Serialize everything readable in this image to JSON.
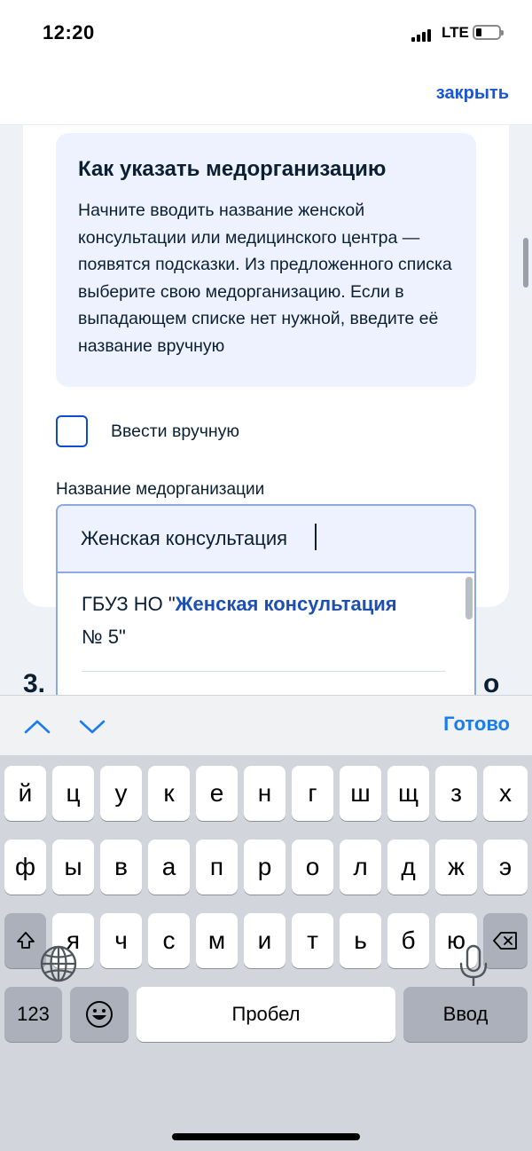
{
  "status_bar": {
    "time": "12:20",
    "network": "LTE"
  },
  "header": {
    "close_label": "закрыть"
  },
  "info_card": {
    "title": "Как указать медорганизацию",
    "text": "Начните вводить название женской консультации или медицинского центра — появятся подсказки. Из предложенного списка выберите свою медорганизацию. Если в выпадающем списке нет нужной, введите её название вручную"
  },
  "manual_checkbox": {
    "label": "Ввести вручную",
    "checked": false
  },
  "org_field": {
    "label": "Название медорганизации",
    "value": "Женская консультация"
  },
  "suggestions": [
    {
      "prefix": "ГБУЗ НО \"",
      "match": "Женская консультация",
      "suffix": "№ 5\""
    }
  ],
  "step": {
    "number": "3.",
    "tail": "о"
  },
  "accessory": {
    "done_label": "Готово"
  },
  "keyboard": {
    "row1": [
      "й",
      "ц",
      "у",
      "к",
      "е",
      "н",
      "г",
      "ш",
      "щ",
      "з",
      "х"
    ],
    "row2": [
      "ф",
      "ы",
      "в",
      "а",
      "п",
      "р",
      "о",
      "л",
      "д",
      "ж",
      "э"
    ],
    "row3": [
      "я",
      "ч",
      "с",
      "м",
      "и",
      "т",
      "ь",
      "б",
      "ю"
    ],
    "numbers_label": "123",
    "space_label": "Пробел",
    "return_label": "Ввод"
  },
  "colors": {
    "accent": "#0d4cd3",
    "info_bg": "#edf2fe",
    "ios_blue": "#1a7cf0"
  }
}
